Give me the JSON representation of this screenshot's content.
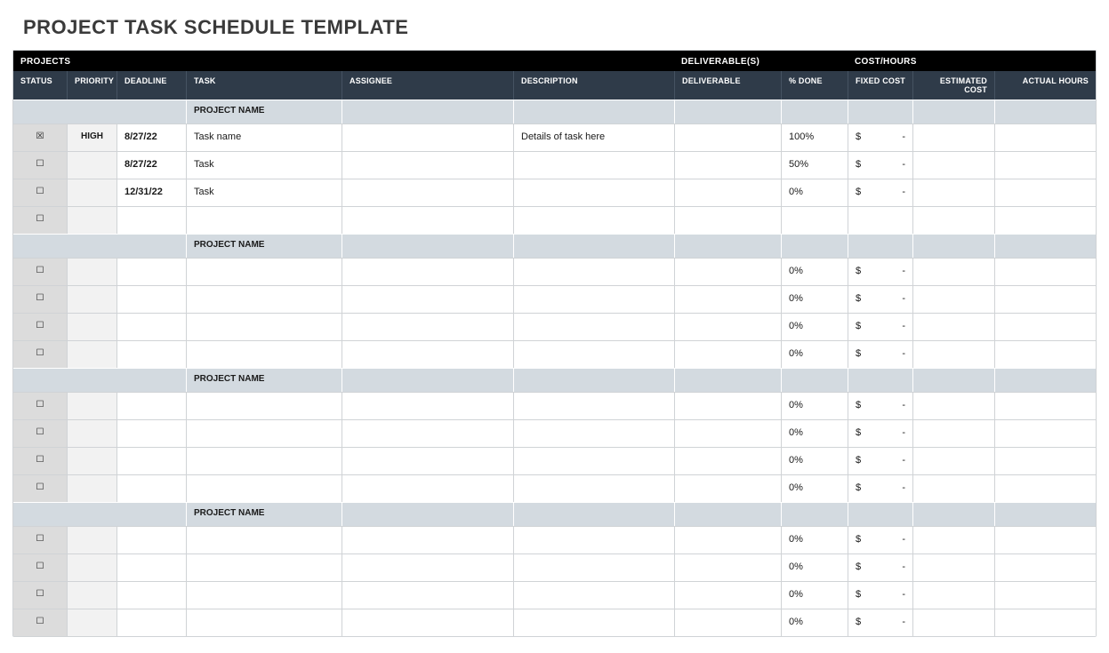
{
  "title": "PROJECT TASK SCHEDULE TEMPLATE",
  "band": {
    "projects": "PROJECTS",
    "deliverables": "DELIVERABLE(S)",
    "costs": "COST/HOURS"
  },
  "columns": {
    "status": "STATUS",
    "priority": "PRIORITY",
    "deadline": "DEADLINE",
    "task": "TASK",
    "assignee": "ASSIGNEE",
    "description": "DESCRIPTION",
    "deliverable": "DELIVERABLE",
    "pct_done": "% DONE",
    "fixed_cost": "FIXED COST",
    "est_cost": "ESTIMATED COST",
    "actual_hours": "ACTUAL HOURS"
  },
  "section_label": "PROJECT NAME",
  "currency_symbol": "$",
  "dash": "-",
  "projects": [
    {
      "name": "PROJECT NAME",
      "rows": [
        {
          "status": "☒",
          "priority": "HIGH",
          "deadline": "8/27/22",
          "task": "Task name",
          "assignee": "",
          "description": "Details of task here",
          "deliverable": "",
          "pct_done": "100%",
          "fixed_cost": "-",
          "est_cost": "",
          "actual_hours": ""
        },
        {
          "status": "☐",
          "priority": "",
          "deadline": "8/27/22",
          "task": "Task",
          "assignee": "",
          "description": "",
          "deliverable": "",
          "pct_done": "50%",
          "fixed_cost": "-",
          "est_cost": "",
          "actual_hours": ""
        },
        {
          "status": "☐",
          "priority": "",
          "deadline": "12/31/22",
          "task": "Task",
          "assignee": "",
          "description": "",
          "deliverable": "",
          "pct_done": "0%",
          "fixed_cost": "-",
          "est_cost": "",
          "actual_hours": ""
        },
        {
          "status": "☐",
          "priority": "",
          "deadline": "",
          "task": "",
          "assignee": "",
          "description": "",
          "deliverable": "",
          "pct_done": "",
          "fixed_cost": "",
          "est_cost": "",
          "actual_hours": ""
        }
      ]
    },
    {
      "name": "PROJECT NAME",
      "rows": [
        {
          "status": "☐",
          "priority": "",
          "deadline": "",
          "task": "",
          "assignee": "",
          "description": "",
          "deliverable": "",
          "pct_done": "0%",
          "fixed_cost": "-",
          "est_cost": "",
          "actual_hours": ""
        },
        {
          "status": "☐",
          "priority": "",
          "deadline": "",
          "task": "",
          "assignee": "",
          "description": "",
          "deliverable": "",
          "pct_done": "0%",
          "fixed_cost": "-",
          "est_cost": "",
          "actual_hours": ""
        },
        {
          "status": "☐",
          "priority": "",
          "deadline": "",
          "task": "",
          "assignee": "",
          "description": "",
          "deliverable": "",
          "pct_done": "0%",
          "fixed_cost": "-",
          "est_cost": "",
          "actual_hours": ""
        },
        {
          "status": "☐",
          "priority": "",
          "deadline": "",
          "task": "",
          "assignee": "",
          "description": "",
          "deliverable": "",
          "pct_done": "0%",
          "fixed_cost": "-",
          "est_cost": "",
          "actual_hours": ""
        }
      ]
    },
    {
      "name": "PROJECT NAME",
      "rows": [
        {
          "status": "☐",
          "priority": "",
          "deadline": "",
          "task": "",
          "assignee": "",
          "description": "",
          "deliverable": "",
          "pct_done": "0%",
          "fixed_cost": "-",
          "est_cost": "",
          "actual_hours": ""
        },
        {
          "status": "☐",
          "priority": "",
          "deadline": "",
          "task": "",
          "assignee": "",
          "description": "",
          "deliverable": "",
          "pct_done": "0%",
          "fixed_cost": "-",
          "est_cost": "",
          "actual_hours": ""
        },
        {
          "status": "☐",
          "priority": "",
          "deadline": "",
          "task": "",
          "assignee": "",
          "description": "",
          "deliverable": "",
          "pct_done": "0%",
          "fixed_cost": "-",
          "est_cost": "",
          "actual_hours": ""
        },
        {
          "status": "☐",
          "priority": "",
          "deadline": "",
          "task": "",
          "assignee": "",
          "description": "",
          "deliverable": "",
          "pct_done": "0%",
          "fixed_cost": "-",
          "est_cost": "",
          "actual_hours": ""
        }
      ]
    },
    {
      "name": "PROJECT NAME",
      "rows": [
        {
          "status": "☐",
          "priority": "",
          "deadline": "",
          "task": "",
          "assignee": "",
          "description": "",
          "deliverable": "",
          "pct_done": "0%",
          "fixed_cost": "-",
          "est_cost": "",
          "actual_hours": ""
        },
        {
          "status": "☐",
          "priority": "",
          "deadline": "",
          "task": "",
          "assignee": "",
          "description": "",
          "deliverable": "",
          "pct_done": "0%",
          "fixed_cost": "-",
          "est_cost": "",
          "actual_hours": ""
        },
        {
          "status": "☐",
          "priority": "",
          "deadline": "",
          "task": "",
          "assignee": "",
          "description": "",
          "deliverable": "",
          "pct_done": "0%",
          "fixed_cost": "-",
          "est_cost": "",
          "actual_hours": ""
        },
        {
          "status": "☐",
          "priority": "",
          "deadline": "",
          "task": "",
          "assignee": "",
          "description": "",
          "deliverable": "",
          "pct_done": "0%",
          "fixed_cost": "-",
          "est_cost": "",
          "actual_hours": ""
        }
      ]
    }
  ]
}
